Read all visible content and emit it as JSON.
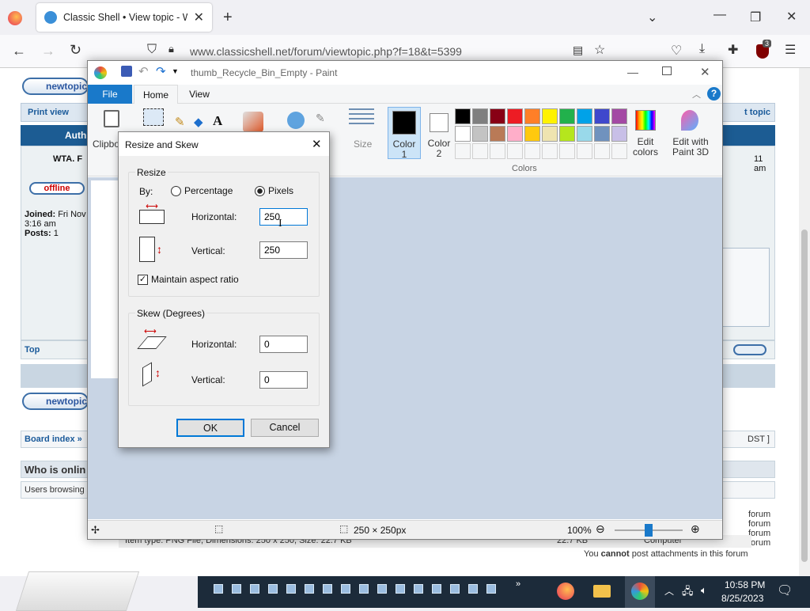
{
  "browser": {
    "tab_title": "Classic Shell • View topic - Win",
    "url": "www.classicshell.net/forum/viewtopic.php?f=18&t=5399",
    "ext_badge": "3"
  },
  "forum": {
    "newtopic": "newtopic",
    "print_view": "Print view",
    "post_topic": "t topic",
    "author": "Auth",
    "poster": "WTA. F",
    "offline": "offline",
    "joined_label": "Joined:",
    "joined_value": "Fri Nov",
    "joined_time": "3:16 am",
    "posts_label": "Posts:",
    "posts_value": "1",
    "time_right": "11 am",
    "top": "Top",
    "board_index": "Board index »",
    "dst": "DST ]",
    "who_online": "Who is onlin",
    "users_browsing": "Users browsing",
    "attach_info": "Item type: PNG File, Dimensions: 250 x 250, Size: 22.7 KB",
    "attach_size": "22.7 KB",
    "computer": "Computer",
    "perm_forum": "forum",
    "no_attach_pre": "You ",
    "no_attach_bold": "cannot",
    "no_attach_post": " post attachments in this forum"
  },
  "paint": {
    "title": "thumb_Recycle_Bin_Empty - Paint",
    "tabs": {
      "file": "File",
      "home": "Home",
      "view": "View"
    },
    "clipboard": "Clipbo",
    "size": "Size",
    "color1": "Color 1",
    "color2": "Color 2",
    "colors_group": "Colors",
    "edit_colors": "Edit colors",
    "edit_paint3d": "Edit with Paint 3D",
    "status_dims": "250 × 250px",
    "zoom": "100%",
    "palette": [
      "#000000",
      "#7f7f7f",
      "#880015",
      "#ed1c24",
      "#ff7f27",
      "#fff200",
      "#22b14c",
      "#00a2e8",
      "#3f48cc",
      "#a349a4",
      "#ffffff",
      "#c3c3c3",
      "#b97a57",
      "#ffaec9",
      "#ffc90e",
      "#efe4b0",
      "#b5e61d",
      "#99d9ea",
      "#7092be",
      "#c8bfe7"
    ]
  },
  "dialog": {
    "title": "Resize and Skew",
    "resize_group": "Resize",
    "by_label": "By:",
    "percentage": "Percentage",
    "pixels": "Pixels",
    "resize_h_label": "Horizontal:",
    "resize_h_value": "250",
    "resize_v_label": "Vertical:",
    "resize_v_value": "250",
    "maintain": "Maintain aspect ratio",
    "skew_group": "Skew (Degrees)",
    "skew_h_label": "Horizontal:",
    "skew_h_value": "0",
    "skew_v_label": "Vertical:",
    "skew_v_value": "0",
    "ok": "OK",
    "cancel": "Cancel"
  },
  "taskbar": {
    "time": "10:58 PM",
    "date": "8/25/2023"
  }
}
